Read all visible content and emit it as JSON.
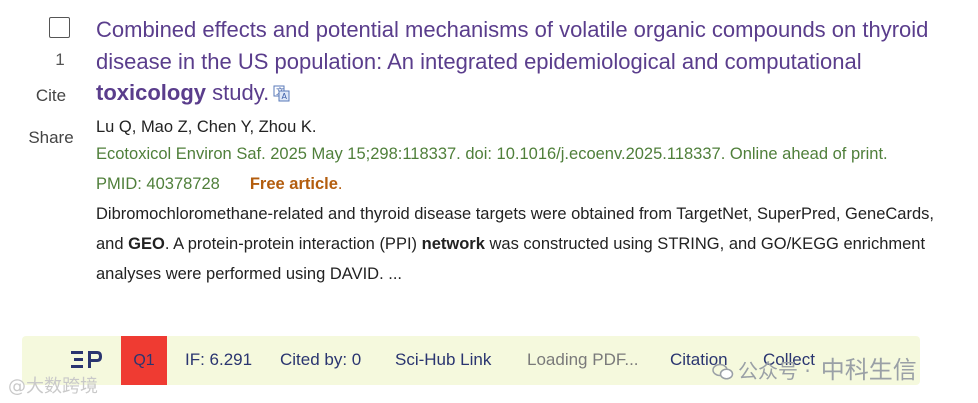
{
  "result": {
    "number": "1",
    "cite_label": "Cite",
    "share_label": "Share",
    "title_part1": "Combined effects and potential mechanisms of volatile organic compounds on thyroid disease in the US population: An integrated epidemiological and computational ",
    "title_bold": "toxicology",
    "title_part2": " study.",
    "authors": "Lu Q, Mao Z, Chen Y, Zhou K.",
    "journal": "Ecotoxicol Environ Saf. 2025 May 15;298:118337. doi: 10.1016/j.ecoenv.2025.118337. Online ahead of print.",
    "pmid": "PMID: 40378728",
    "free_article": "Free article",
    "free_article_dot": ".",
    "snippet_part1": "Dibromochloromethane-related and thyroid disease targets were obtained from TargetNet, SuperPred, GeneCards, and ",
    "snippet_bold1": "GEO",
    "snippet_part2": ". A protein-protein interaction (PPI) ",
    "snippet_bold2": "network",
    "snippet_part3": " was constructed using STRING, and GO/KEGG enrichment analyses were performed using DAVID. ..."
  },
  "toolbar": {
    "quartile": "Q1",
    "impact_factor": "IF: 6.291",
    "cited_by": "Cited by: 0",
    "scihub": "Sci-Hub Link",
    "loading": "Loading PDF...",
    "citation": "Citation",
    "collect": "Collect"
  },
  "watermarks": {
    "left": "@大数跨境",
    "right_small": "公众号 ·",
    "right_big": "中科生信"
  },
  "colors": {
    "title": "#5a3d8c",
    "journal": "#4f7f3a",
    "free_article": "#b35d0e",
    "toolbar_bg": "#f5f9dd",
    "quartile_bg": "#ef3b32",
    "toolbar_text": "#2a3570"
  }
}
